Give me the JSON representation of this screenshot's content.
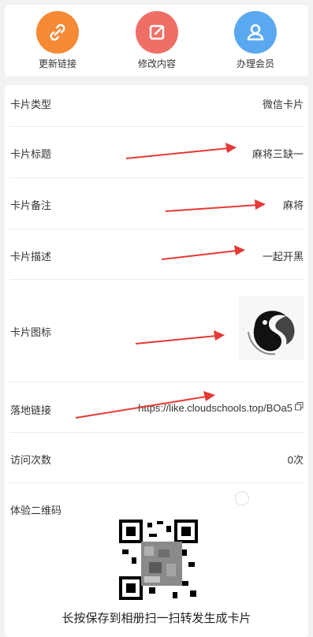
{
  "top_actions": [
    {
      "label": "更新链接",
      "color": "#f58a36",
      "icon": "link-icon"
    },
    {
      "label": "修改内容",
      "color": "#ef6f67",
      "icon": "edit-icon"
    },
    {
      "label": "办理会员",
      "color": "#5aa9f0",
      "icon": "user-icon"
    }
  ],
  "details": {
    "card_type": {
      "label": "卡片类型",
      "value": "微信卡片"
    },
    "card_title": {
      "label": "卡片标题",
      "value": "麻将三缺一"
    },
    "card_note": {
      "label": "卡片备注",
      "value": "麻将"
    },
    "card_desc": {
      "label": "卡片描述",
      "value": "一起开黑"
    },
    "card_icon": {
      "label": "卡片图标"
    },
    "landing_link": {
      "label": "落地链接",
      "value": "https://like.cloudschools.top/BOa5"
    },
    "visit_count": {
      "label": "访问次数",
      "value": "0次"
    },
    "qr_section": {
      "label": "体验二维码",
      "caption": "长按保存到相册扫一扫转发生成卡片"
    }
  },
  "colors": {
    "arrow": "#e53935"
  }
}
